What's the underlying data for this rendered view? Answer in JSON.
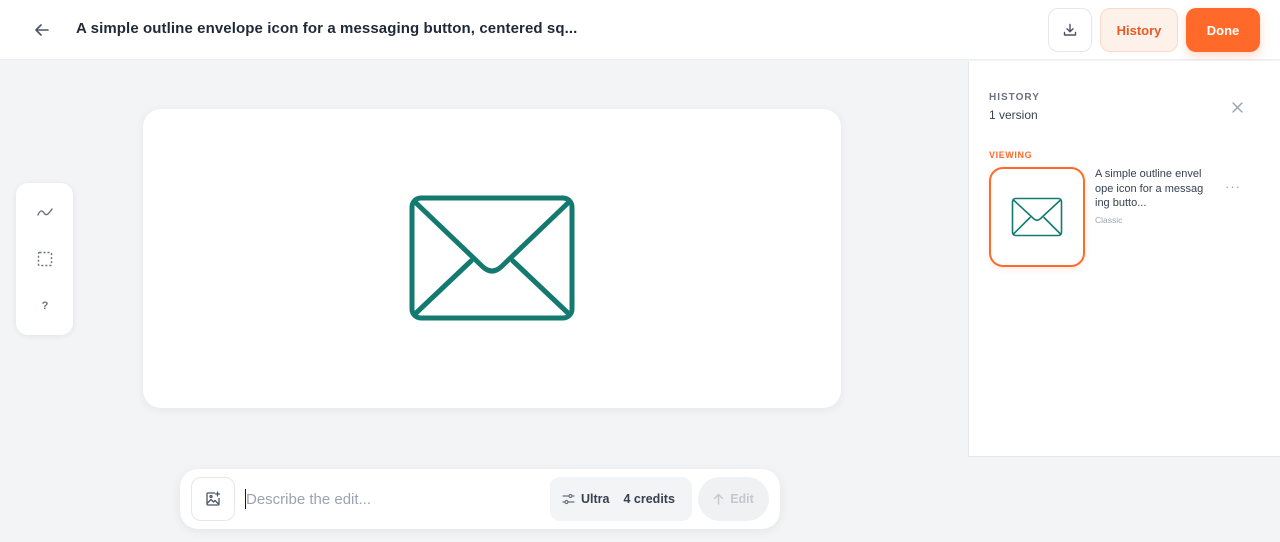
{
  "header": {
    "title": "A simple outline envelope icon for a messaging button, centered sq...",
    "history_label": "History",
    "done_label": "Done",
    "icons": {
      "back": "arrow-left-icon",
      "download": "download-icon"
    }
  },
  "toolbar": {
    "tools": [
      {
        "name": "draw-tool",
        "icon": "squiggle-icon"
      },
      {
        "name": "select-tool",
        "icon": "dashed-square-icon"
      },
      {
        "name": "help-tool",
        "icon": "question-icon",
        "glyph": "?"
      }
    ]
  },
  "canvas": {
    "image_icon": "envelope-icon",
    "icon_color": "#147a70"
  },
  "history_panel": {
    "heading": "HISTORY",
    "count": "1 version",
    "viewing_label": "VIEWING",
    "versions": [
      {
        "description": "A simple outline envelope icon for a messaging butto...",
        "style": "Classic"
      }
    ]
  },
  "prompt_bar": {
    "placeholder": "Describe the edit...",
    "model": "Ultra",
    "credits": "4 credits",
    "edit_label": "Edit"
  },
  "colors": {
    "accent": "#ff6a2b",
    "accent_soft": "#fdf1ea",
    "icon_teal": "#147a70"
  }
}
